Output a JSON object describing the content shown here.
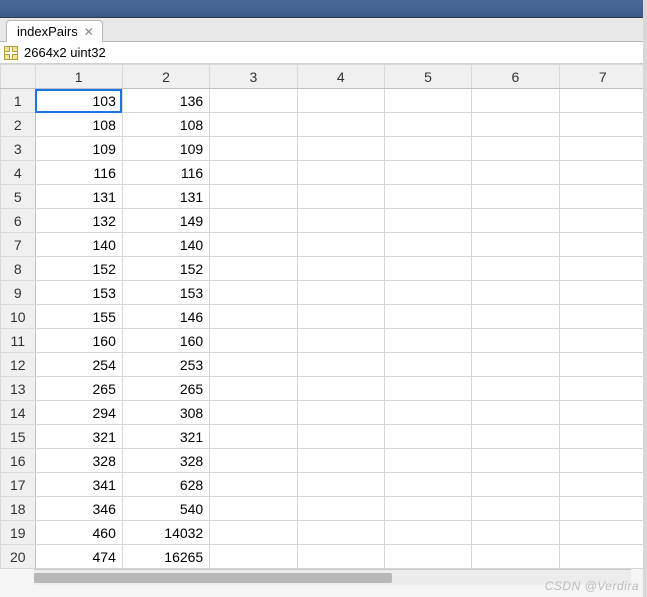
{
  "tab": {
    "title": "indexPairs"
  },
  "info": {
    "summary": "2664x2 uint32"
  },
  "grid": {
    "col_headers": [
      "1",
      "2",
      "3",
      "4",
      "5",
      "6",
      "7"
    ],
    "row_headers": [
      "1",
      "2",
      "3",
      "4",
      "5",
      "6",
      "7",
      "8",
      "9",
      "10",
      "11",
      "12",
      "13",
      "14",
      "15",
      "16",
      "17",
      "18",
      "19",
      "20"
    ],
    "selected": {
      "row": 0,
      "col": 0
    },
    "rows": [
      [
        "103",
        "136",
        "",
        "",
        "",
        "",
        ""
      ],
      [
        "108",
        "108",
        "",
        "",
        "",
        "",
        ""
      ],
      [
        "109",
        "109",
        "",
        "",
        "",
        "",
        ""
      ],
      [
        "116",
        "116",
        "",
        "",
        "",
        "",
        ""
      ],
      [
        "131",
        "131",
        "",
        "",
        "",
        "",
        ""
      ],
      [
        "132",
        "149",
        "",
        "",
        "",
        "",
        ""
      ],
      [
        "140",
        "140",
        "",
        "",
        "",
        "",
        ""
      ],
      [
        "152",
        "152",
        "",
        "",
        "",
        "",
        ""
      ],
      [
        "153",
        "153",
        "",
        "",
        "",
        "",
        ""
      ],
      [
        "155",
        "146",
        "",
        "",
        "",
        "",
        ""
      ],
      [
        "160",
        "160",
        "",
        "",
        "",
        "",
        ""
      ],
      [
        "254",
        "253",
        "",
        "",
        "",
        "",
        ""
      ],
      [
        "265",
        "265",
        "",
        "",
        "",
        "",
        ""
      ],
      [
        "294",
        "308",
        "",
        "",
        "",
        "",
        ""
      ],
      [
        "321",
        "321",
        "",
        "",
        "",
        "",
        ""
      ],
      [
        "328",
        "328",
        "",
        "",
        "",
        "",
        ""
      ],
      [
        "341",
        "628",
        "",
        "",
        "",
        "",
        ""
      ],
      [
        "346",
        "540",
        "",
        "",
        "",
        "",
        ""
      ],
      [
        "460",
        "14032",
        "",
        "",
        "",
        "",
        ""
      ],
      [
        "474",
        "16265",
        "",
        "",
        "",
        "",
        ""
      ]
    ]
  },
  "watermark": "CSDN @Verdira"
}
